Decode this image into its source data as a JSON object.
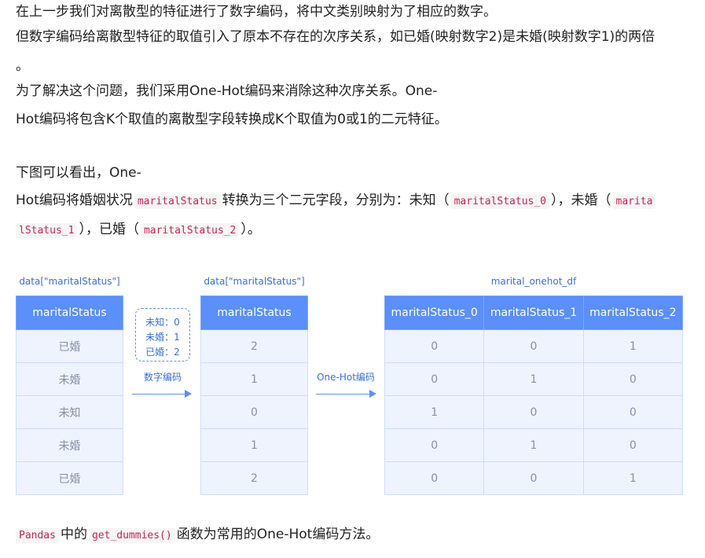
{
  "paragraphs": {
    "l1": "在上一步我们对离散型的特征进行了数字编码，将中文类别映射为了相应的数字。",
    "l2": "但数字编码给离散型特征的取值引入了原本不存在的次序关系，如已婚(映射数字2)是未婚(映射数字1)的两倍",
    "l3": "。",
    "l4": "为了解决这个问题，我们采用One-Hot编码来消除这种次序关系。One-",
    "l5": "Hot编码将包含K个取值的离散型字段转换成K个取值为0或1的二元特征。",
    "l6": "下图可以看出，One-",
    "l7": {
      "t1": "Hot编码将婚姻状况",
      "c1": "maritalStatus",
      "t2": "转换为三个二元字段，分别为：未知（",
      "c2": "maritalStatus_0",
      "t3": "），未婚（",
      "c3": "marita"
    },
    "l8": {
      "c1": "lStatus_1",
      "t1": "），已婚（",
      "c2": "maritalStatus_2",
      "t2": "）。"
    },
    "last": {
      "c1": "Pandas",
      "t1": "中的",
      "c2": "get_dummies()",
      "t2": "函数为常用的One-Hot编码方法。"
    }
  },
  "figure": {
    "caption_left": "data[\"maritalStatus\"]",
    "caption_mid": "data[\"maritalStatus\"]",
    "caption_right": "marital_onehot_df",
    "table_left": {
      "header": "maritalStatus",
      "rows": [
        "已婚",
        "未婚",
        "未知",
        "未婚",
        "已婚"
      ]
    },
    "mapping": [
      "未知：0",
      "未婚：1",
      "已婚：2"
    ],
    "arrow1_label": "数字编码",
    "table_mid": {
      "header": "maritalStatus",
      "rows": [
        "2",
        "1",
        "0",
        "1",
        "2"
      ]
    },
    "arrow2_label": "One-Hot编码",
    "table_right": {
      "headers": [
        "maritalStatus_0",
        "maritalStatus_1",
        "maritalStatus_2"
      ],
      "rows": [
        [
          "0",
          "0",
          "1"
        ],
        [
          "0",
          "1",
          "0"
        ],
        [
          "1",
          "0",
          "0"
        ],
        [
          "0",
          "1",
          "0"
        ],
        [
          "0",
          "0",
          "1"
        ]
      ]
    },
    "colors": {
      "header_bg": "#5b8ff9",
      "cell_bg": "#eef3fe",
      "accent": "#3a6fd8"
    }
  }
}
